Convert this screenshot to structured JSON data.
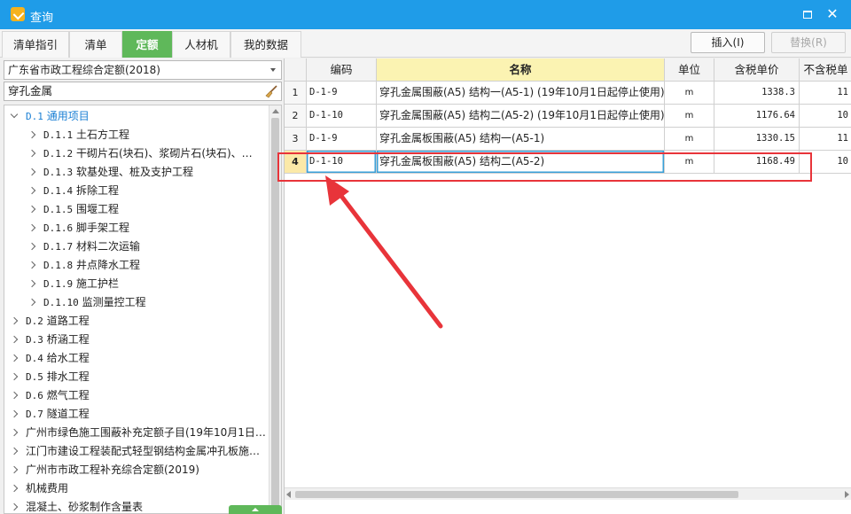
{
  "window": {
    "title": "查询"
  },
  "tabs": [
    {
      "label": "清单指引"
    },
    {
      "label": "清单"
    },
    {
      "label": "定额"
    },
    {
      "label": "人材机"
    },
    {
      "label": "我的数据"
    }
  ],
  "toolbar": {
    "insert_label": "插入(I)",
    "replace_label": "替换(R)"
  },
  "left_panel": {
    "quota_select": "广东省市政工程综合定额(2018)",
    "search_value": "穿孔金属",
    "tree": [
      {
        "code": "D.1",
        "label": "通用项目",
        "level": 0,
        "expanded": true,
        "selected": true
      },
      {
        "code": "D.1.1",
        "label": "土石方工程",
        "level": 1
      },
      {
        "code": "D.1.2",
        "label": "干砌片石(块石)、浆砌片石(块石)、…",
        "level": 1
      },
      {
        "code": "D.1.3",
        "label": "软基处理、桩及支护工程",
        "level": 1
      },
      {
        "code": "D.1.4",
        "label": "拆除工程",
        "level": 1
      },
      {
        "code": "D.1.5",
        "label": "围堰工程",
        "level": 1
      },
      {
        "code": "D.1.6",
        "label": "脚手架工程",
        "level": 1
      },
      {
        "code": "D.1.7",
        "label": "材料二次运输",
        "level": 1
      },
      {
        "code": "D.1.8",
        "label": "井点降水工程",
        "level": 1
      },
      {
        "code": "D.1.9",
        "label": "施工护栏",
        "level": 1
      },
      {
        "code": "D.1.10",
        "label": "监测量控工程",
        "level": 1
      },
      {
        "code": "D.2",
        "label": "道路工程",
        "level": 0
      },
      {
        "code": "D.3",
        "label": "桥涵工程",
        "level": 0
      },
      {
        "code": "D.4",
        "label": "给水工程",
        "level": 0
      },
      {
        "code": "D.5",
        "label": "排水工程",
        "level": 0
      },
      {
        "code": "D.6",
        "label": "燃气工程",
        "level": 0
      },
      {
        "code": "D.7",
        "label": "隧道工程",
        "level": 0
      },
      {
        "code": "",
        "label": "广州市绿色施工围蔽补充定额子目(19年10月1日…",
        "level": 0
      },
      {
        "code": "",
        "label": "江门市建设工程装配式轻型钢结构金属冲孔板施…",
        "level": 0
      },
      {
        "code": "",
        "label": "广州市市政工程补充综合定额(2019)",
        "level": 0
      },
      {
        "code": "",
        "label": "机械费用",
        "level": 0
      },
      {
        "code": "",
        "label": "混凝土、砂浆制作含量表",
        "level": 0
      }
    ]
  },
  "grid": {
    "headers": {
      "code": "编码",
      "name": "名称",
      "unit": "单位",
      "tax_price": "含税单价",
      "notax_price": "不含税单"
    },
    "rows": [
      {
        "num": "1",
        "code": "D-1-9",
        "name": "穿孔金属围蔽(A5) 结构一(A5-1) (19年10月1日起停止使用)",
        "unit": "m",
        "tax_price": "1338.3",
        "notax_price": "11"
      },
      {
        "num": "2",
        "code": "D-1-10",
        "name": "穿孔金属围蔽(A5) 结构二(A5-2) (19年10月1日起停止使用)",
        "unit": "m",
        "tax_price": "1176.64",
        "notax_price": "10"
      },
      {
        "num": "3",
        "code": "D-1-9",
        "name": "穿孔金属板围蔽(A5) 结构一(A5-1)",
        "unit": "m",
        "tax_price": "1330.15",
        "notax_price": "11"
      },
      {
        "num": "4",
        "code": "D-1-10",
        "name": "穿孔金属板围蔽(A5) 结构二(A5-2)",
        "unit": "m",
        "tax_price": "1168.49",
        "notax_price": "10"
      }
    ],
    "selected_row": 4
  },
  "colors": {
    "titlebar": "#1f9ce8",
    "active_tab": "#5fb85a",
    "highlight": "#e8343a",
    "selected_tree": "#1a7fd4"
  }
}
